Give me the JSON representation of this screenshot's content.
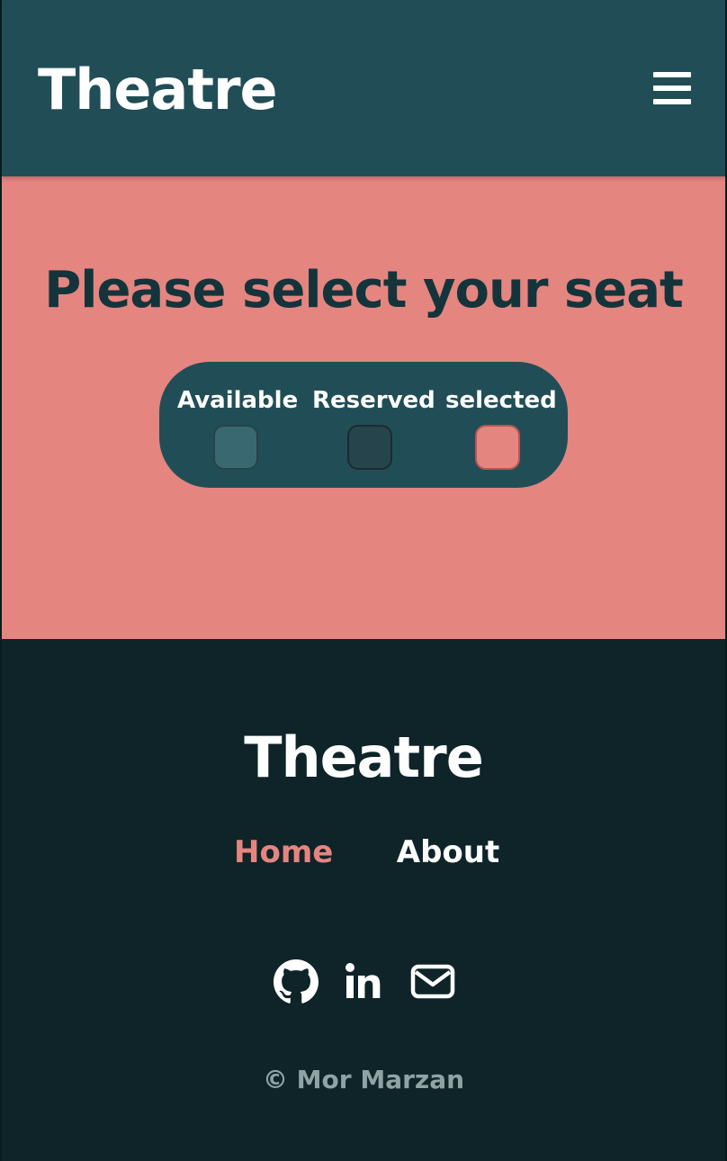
{
  "header": {
    "brand": "Theatre",
    "menu_icon": "hamburger-menu-icon"
  },
  "main": {
    "title": "Please select your seat",
    "legend": [
      {
        "label": "Available",
        "color": "#3a6870"
      },
      {
        "label": "Reserved",
        "color": "#25444b"
      },
      {
        "label": "selected",
        "color": "#e58580"
      }
    ]
  },
  "footer": {
    "brand": "Theatre",
    "nav": [
      {
        "label": "Home",
        "active": true,
        "color": "#e58580"
      },
      {
        "label": "About",
        "active": false,
        "color": "#ffffff"
      }
    ],
    "social": [
      {
        "icon": "github-icon"
      },
      {
        "icon": "linkedin-icon"
      },
      {
        "icon": "mail-icon"
      }
    ],
    "copyright": "© Mor Marzan"
  },
  "colors": {
    "header_bg": "#214e56",
    "main_bg": "#e58580",
    "footer_bg": "#0e2429",
    "title_text": "#14343b"
  }
}
